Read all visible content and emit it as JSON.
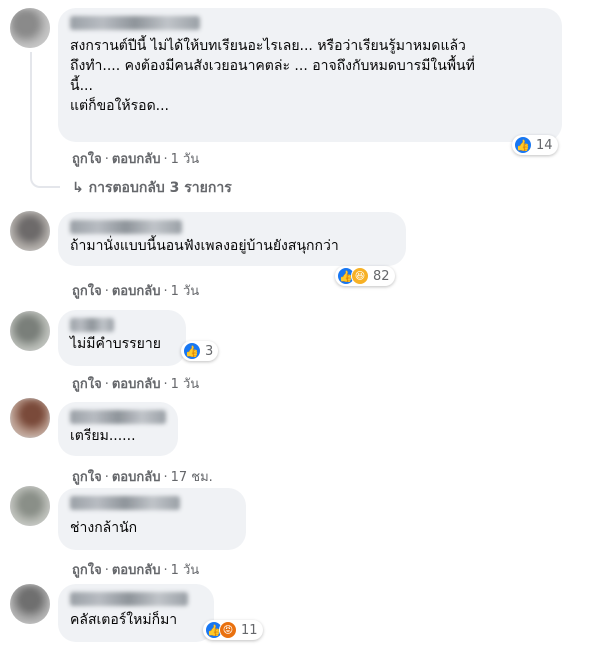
{
  "actions": {
    "like": "ถูกใจ",
    "reply": "ตอบกลับ",
    "dot": "·"
  },
  "comments": [
    {
      "text": "สงกรานต์ปีนี้ ไม่ได้ให้บทเรียนอะไรเลย... หรือว่าเรียนรู้มาหมดแล้ว\nถึงทำ.... คงต้องมีคนสังเวยอนาคตล่ะ ... อาจถึงกับหมดบารมีในพื้นที่\nนี้...\nแต่ก็ขอให้รอด...",
      "time": "1 วัน",
      "reactions": {
        "icons": [
          "like-icon"
        ],
        "count": "14"
      },
      "replies": "การตอบกลับ 3 รายการ"
    },
    {
      "text": "ถ้ามานั่งแบบนี้นอนฟังเพลงอยู่บ้านยังสนุกกว่า",
      "time": "1 วัน",
      "reactions": {
        "icons": [
          "like-icon",
          "haha-icon"
        ],
        "count": "82"
      }
    },
    {
      "text": "ไม่มีคำบรรยาย",
      "time": "1 วัน",
      "reactions": {
        "icons": [
          "like-icon"
        ],
        "count": "3"
      }
    },
    {
      "text": "เตรียม......",
      "time": "17 ชม."
    },
    {
      "text": "ช่างกล้านัก",
      "time": "1 วัน"
    },
    {
      "text": "คลัสเตอร์ใหม่ก็มา",
      "reactions": {
        "icons": [
          "like-icon",
          "angry-icon"
        ],
        "count": "11"
      }
    }
  ],
  "colors": {
    "bubble": "#f0f2f5",
    "meta": "#65676b",
    "like": "#1877f2",
    "haha": "#f7b125",
    "angry": "#e9710f"
  }
}
